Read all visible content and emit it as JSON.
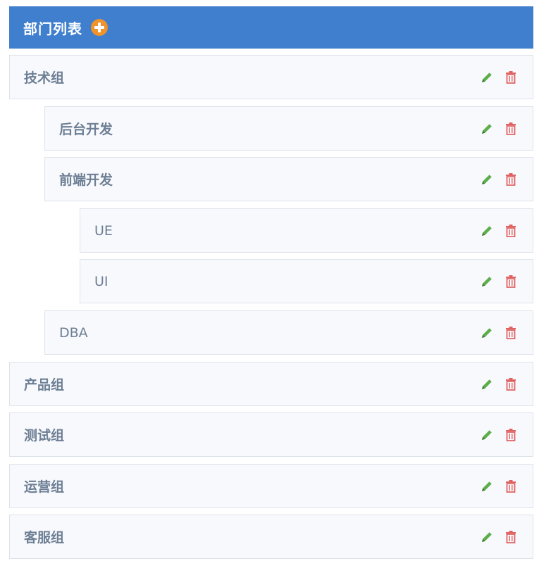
{
  "header": {
    "title": "部门列表"
  },
  "colors": {
    "header_bg": "#3f7fce",
    "add": "#f0932b",
    "edit": "#5cae4a",
    "delete": "#e06363",
    "text": "#6d7f94"
  },
  "departments": [
    {
      "label": "技术组",
      "level": 0
    },
    {
      "label": "后台开发",
      "level": 1
    },
    {
      "label": "前端开发",
      "level": 1
    },
    {
      "label": "UE",
      "level": 2
    },
    {
      "label": "UI",
      "level": 2
    },
    {
      "label": "DBA",
      "level": 1
    },
    {
      "label": "产品组",
      "level": 0
    },
    {
      "label": "测试组",
      "level": 0
    },
    {
      "label": "运营组",
      "level": 0
    },
    {
      "label": "客服组",
      "level": 0
    }
  ]
}
